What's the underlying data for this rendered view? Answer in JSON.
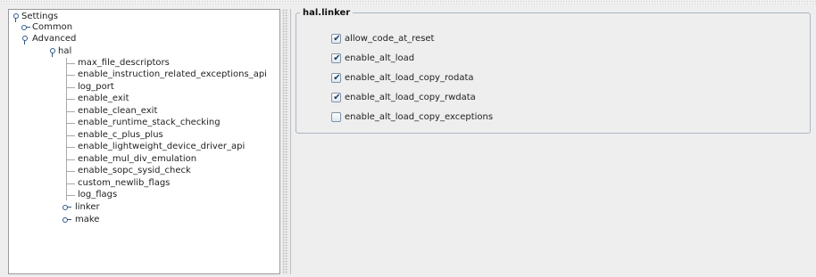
{
  "tree": {
    "root_label": "Settings",
    "common_label": "Common",
    "advanced_label": "Advanced",
    "hal_label": "hal",
    "hal_children": [
      "max_file_descriptors",
      "enable_instruction_related_exceptions_api",
      "log_port",
      "enable_exit",
      "enable_clean_exit",
      "enable_runtime_stack_checking",
      "enable_c_plus_plus",
      "enable_lightweight_device_driver_api",
      "enable_mul_div_emulation",
      "enable_sopc_sysid_check",
      "custom_newlib_flags",
      "log_flags"
    ],
    "linker_label": "linker",
    "make_label": "make"
  },
  "panel": {
    "title": "hal.linker",
    "options": [
      {
        "label": "allow_code_at_reset",
        "checked": true
      },
      {
        "label": "enable_alt_load",
        "checked": true
      },
      {
        "label": "enable_alt_load_copy_rodata",
        "checked": true
      },
      {
        "label": "enable_alt_load_copy_rwdata",
        "checked": true
      },
      {
        "label": "enable_alt_load_copy_exceptions",
        "checked": false
      }
    ],
    "check_glyph": "✔"
  },
  "colors": {
    "key_icon": "#2f5a87",
    "checkbox_border": "#7f93a8",
    "group_border": "#a9b6c4"
  }
}
